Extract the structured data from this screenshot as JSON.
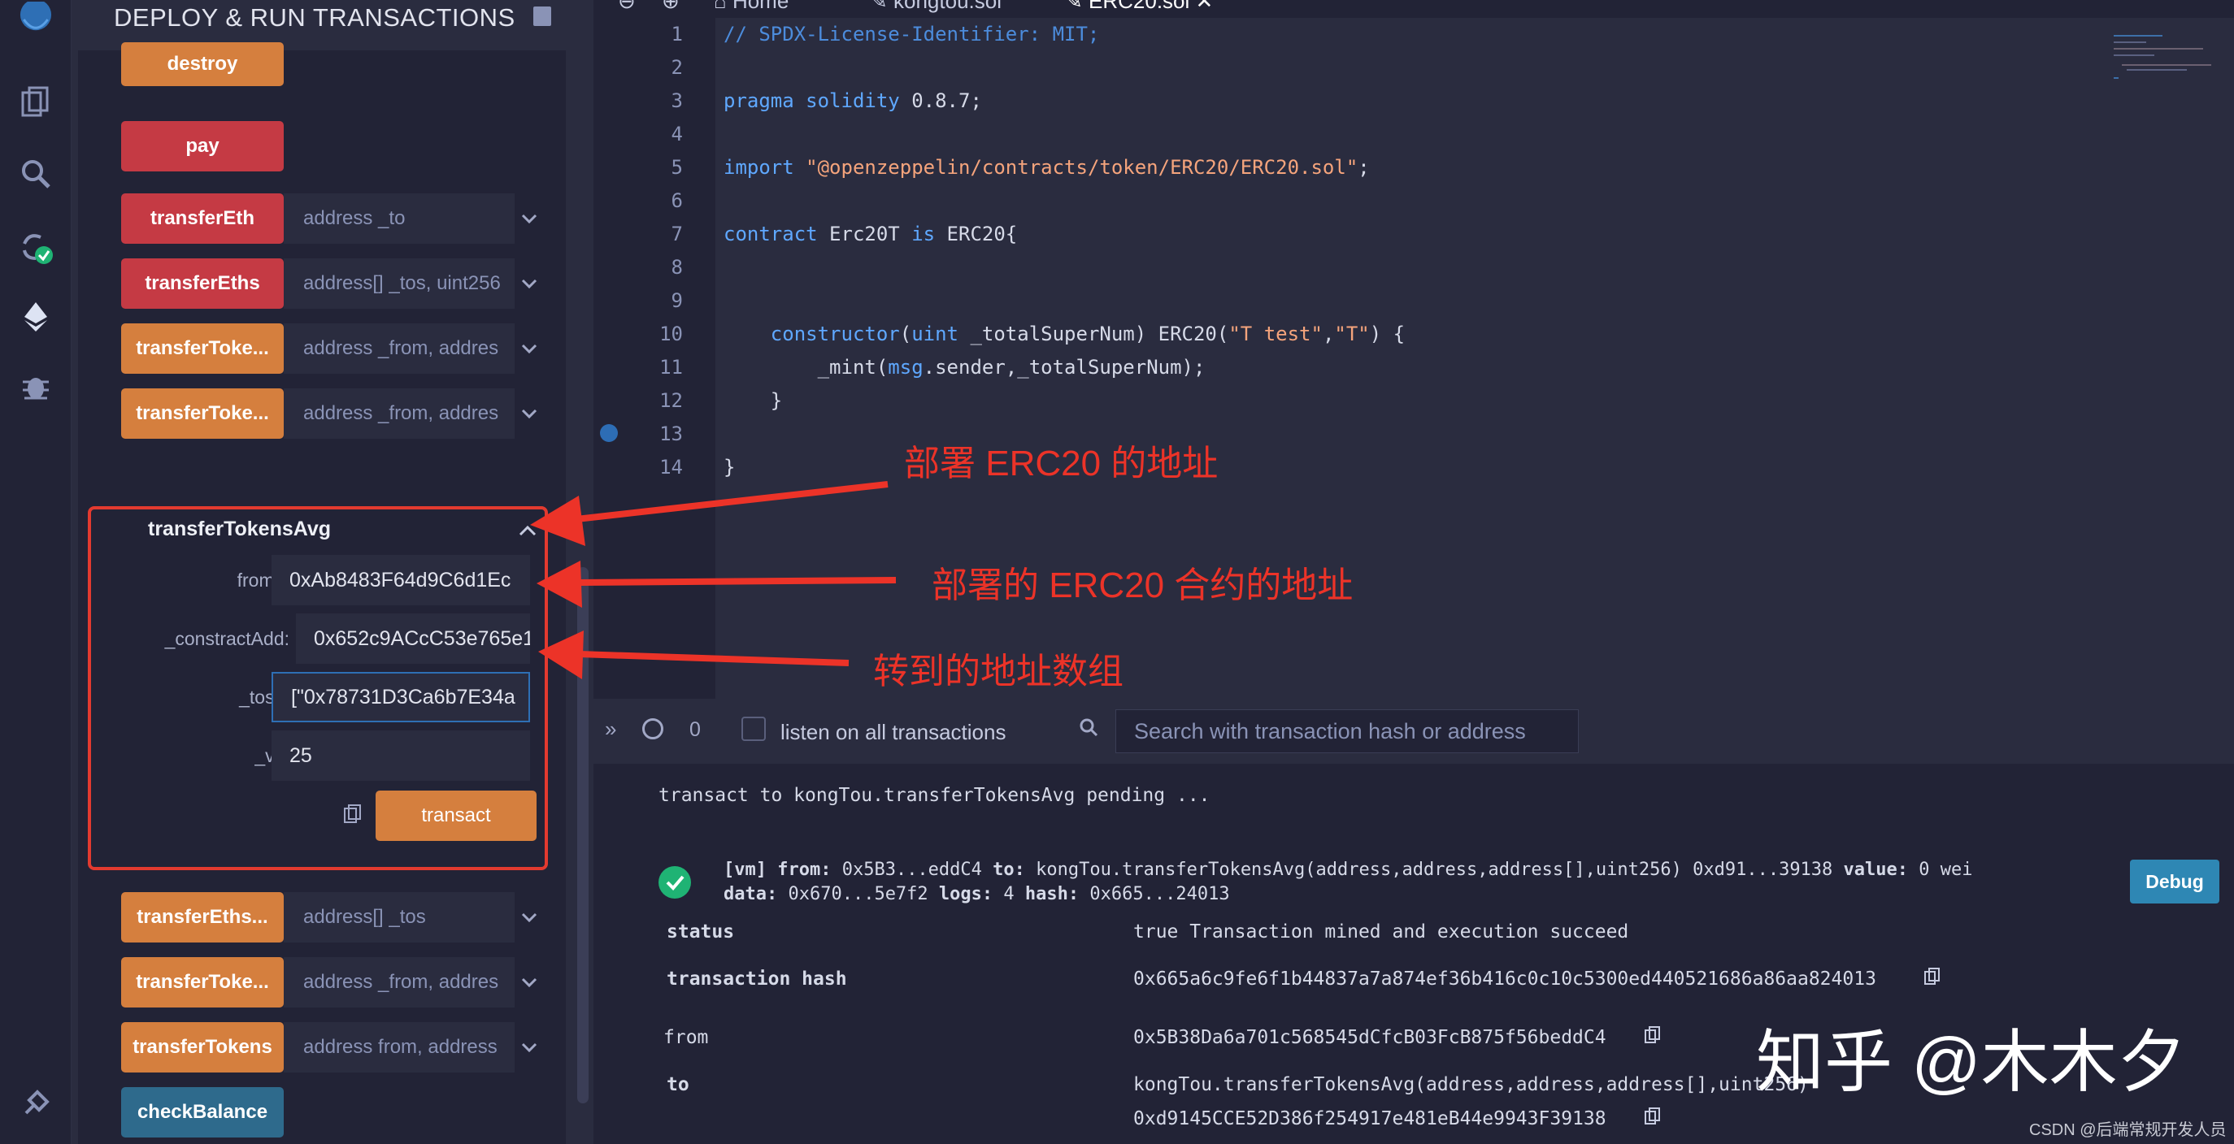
{
  "panel": {
    "title": "DEPLOY & RUN TRANSACTIONS",
    "functions": [
      {
        "label": "destroy",
        "placeholder": ""
      },
      {
        "label": "pay",
        "placeholder": ""
      },
      {
        "label": "transferEth",
        "placeholder": "address _to"
      },
      {
        "label": "transferEths",
        "placeholder": "address[] _tos, uint256"
      },
      {
        "label": "transferToke...",
        "placeholder": "address _from, addres"
      },
      {
        "label": "transferToke...",
        "placeholder": "address _from, addres"
      },
      {
        "label": "transferEths...",
        "placeholder": "address[] _tos"
      },
      {
        "label": "transferToke...",
        "placeholder": "address _from, addres"
      },
      {
        "label": "transferTokens",
        "placeholder": "address from, address"
      },
      {
        "label": "checkBalance",
        "placeholder": ""
      }
    ],
    "expanded": {
      "title": "transferTokensAvg",
      "params": [
        {
          "label": "from:",
          "value": "0xAb8483F64d9C6d1Ec"
        },
        {
          "label": "_constractAdd:",
          "value": "0x652c9ACcC53e765e1"
        },
        {
          "label": "_tos:",
          "value": "[\"0x78731D3Ca6b7E34a"
        },
        {
          "label": "_v:",
          "value": "25"
        }
      ],
      "transact_label": "transact"
    }
  },
  "tabs": [
    {
      "label": "Home"
    },
    {
      "label": "kongtou.sol"
    },
    {
      "label": "ERC20.sol"
    }
  ],
  "editor": {
    "lines": [
      {
        "n": "1",
        "html": "<span class='c-cmt'>// SPDX-License-Identifier: MIT;</span>"
      },
      {
        "n": "2",
        "html": ""
      },
      {
        "n": "3",
        "html": "<span class='c-kw'>pragma solidity</span> 0.8.7;"
      },
      {
        "n": "4",
        "html": ""
      },
      {
        "n": "5",
        "html": "<span class='c-kw'>import</span> <span class='c-str'>\"@openzeppelin/contracts/token/ERC20/ERC20.sol\"</span>;"
      },
      {
        "n": "6",
        "html": ""
      },
      {
        "n": "7",
        "html": "<span class='c-kw'>contract</span> Erc20T <span class='c-kw'>is</span> ERC20{"
      },
      {
        "n": "8",
        "html": ""
      },
      {
        "n": "9",
        "html": ""
      },
      {
        "n": "10",
        "html": "    <span class='c-kw'>constructor</span>(<span class='c-type'>uint</span> _totalSuperNum) ERC20(<span class='c-str'>\"T test\"</span>,<span class='c-str'>\"T\"</span>) {"
      },
      {
        "n": "11",
        "html": "        _mint(<span class='c-type'>msg</span>.sender,_totalSuperNum);"
      },
      {
        "n": "12",
        "html": "    }"
      },
      {
        "n": "13",
        "html": ""
      },
      {
        "n": "14",
        "html": "}"
      }
    ]
  },
  "terminal": {
    "count": "0",
    "listen_label": "listen on all transactions",
    "search_placeholder": "Search with transaction hash or address",
    "pending": "transact to kongTou.transferTokensAvg pending ...",
    "summary1_pre": "[vm]",
    "summary1_from_k": "from:",
    "summary1_from_v": "0x5B3...eddC4",
    "summary1_to_k": "to:",
    "summary1_to_v": "kongTou.transferTokensAvg(address,address,address[],uint256) 0xd91...39138",
    "summary1_value_k": "value:",
    "summary1_value_v": "0 wei",
    "summary2_data_k": "data:",
    "summary2_data_v": "0x670...5e7f2",
    "summary2_logs_k": "logs:",
    "summary2_logs_v": "4",
    "summary2_hash_k": "hash:",
    "summary2_hash_v": "0x665...24013",
    "debug_label": "Debug",
    "rows": [
      {
        "key": "status",
        "value": "true Transaction mined and execution succeed"
      },
      {
        "key": "transaction hash",
        "value": "0x665a6c9fe6f1b44837a7a874ef36b416c0c10c5300ed440521686a86aa824013"
      },
      {
        "key": "from",
        "value": "0x5B38Da6a701c568545dCfcB03FcB875f56beddC4"
      },
      {
        "key": "to",
        "value": "kongTou.transferTokensAvg(address,address,address[],uint256)"
      },
      {
        "key": "",
        "value": "0xd9145CCE52D386f254917e481eB44e9943F39138"
      }
    ]
  },
  "annotations": {
    "a1": "部署 ERC20 的地址",
    "a2": "部署的 ERC20 合约的地址",
    "a3": "转到的地址数组",
    "color": "#ec3328"
  },
  "watermark": "知乎 @木木夕",
  "csdn": "CSDN @后端常规开发人员"
}
